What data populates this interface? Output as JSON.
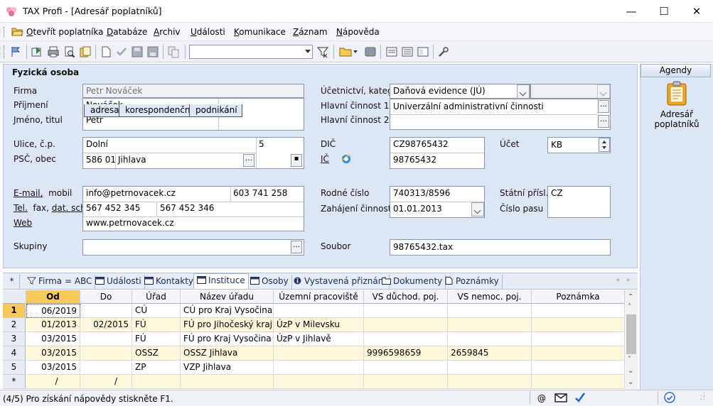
{
  "window": {
    "title": "TAX Profi - [Adresář poplatníků]",
    "minimize_glyph": "—",
    "maximize_glyph": "☐",
    "close_glyph": "✕"
  },
  "menu": {
    "open_u": "O",
    "open_rest": "tevřít poplatníka",
    "db_u": "D",
    "db_rest": "atabáze",
    "archive_u": "A",
    "archive_rest": "rchiv",
    "events_u": "U",
    "events_rest": "dálosti",
    "comm_u": "K",
    "comm_rest": "omunikace",
    "record_u": "Z",
    "record_rest": "áznam",
    "help_u": "N",
    "help_rest": "ápověda"
  },
  "form": {
    "section_title": "Fyzická osoba",
    "labels": {
      "firma": "Firma",
      "prijmeni": "Příjmení",
      "jmeno": "Jméno, titul",
      "ulice": "Ulice, č.p.",
      "psc": "PSČ, obec",
      "email": "E-mail,",
      "mobil": "mobil",
      "tel": "Tel.",
      "fax": "fax,",
      "datschr": "dat. schr.",
      "web": "Web",
      "skupiny": "Skupiny",
      "ucetnictvi": "Účetnictví, kateg.",
      "cinnost1": "Hlavní činnost 1",
      "cinnost2": "Hlavní činnost 2",
      "dic": "DIČ",
      "ic": "IČ",
      "ucet": "Účet",
      "rodne": "Rodné číslo",
      "zahajeni": "Zahájení činnosti",
      "statni": "Státní přísl.",
      "pas": "Číslo pasu",
      "soubor": "Soubor"
    },
    "values": {
      "firma": "Petr Nováček",
      "prijmeni": "Nováček",
      "jmeno": "Petr",
      "ulice": "Dolní",
      "cp": "5",
      "psc": "586 01",
      "obec": "Jihlava",
      "email": "info@petrnovacek.cz",
      "mobil": "603 741 258",
      "tel": "567 452 345",
      "fax": "567 452 346",
      "web": "www.petrnovacek.cz",
      "skupiny": "",
      "ucetnictvi": "Daňová evidence (JÚ)",
      "cinnost1": "Univerzální administrativní činnosti",
      "cinnost2": "",
      "dic": "CZ98765432",
      "ic": "98765432",
      "ucet": "KB",
      "rodne": "740313/8596",
      "zahajeni": "01.01.2013",
      "statni": "CZ",
      "pas": "",
      "soubor": "98765432.tax"
    },
    "address_tabs": [
      "adresa",
      "korespondenční",
      "podnikání"
    ]
  },
  "agenda": {
    "header": "Agendy",
    "item_line1": "Adresář",
    "item_line2": "poplatníků"
  },
  "tabs": {
    "asterisk": "*",
    "firma": "Firma = ABC",
    "udalosti": "Události",
    "kontakty": "Kontakty",
    "instituce": "Instituce",
    "osoby": "Osoby",
    "priznani": "Vystavená přiznání",
    "dokumenty": "Dokumenty",
    "poznamky": "Poznámky"
  },
  "grid": {
    "columns": [
      "Od",
      "Do",
      "Úřad",
      "Název úřadu",
      "Územní pracoviště",
      "VS důchod. poj.",
      "VS nemoc. poj.",
      "Poznámka"
    ],
    "rows": [
      {
        "n": "1",
        "od": "06/2019",
        "do": "",
        "urad": "CÚ",
        "nazev": "CÚ pro Kraj Vysočina",
        "uzemni": "",
        "vsd": "",
        "vsn": "",
        "pozn": ""
      },
      {
        "n": "2",
        "od": "01/2013",
        "do": "02/2015",
        "urad": "FÚ",
        "nazev": "FÚ pro Jihočeský kraj",
        "uzemni": "ÚzP v Milevsku",
        "vsd": "",
        "vsn": "",
        "pozn": ""
      },
      {
        "n": "3",
        "od": "03/2015",
        "do": "",
        "urad": "FÚ",
        "nazev": "FÚ pro Kraj Vysočina",
        "uzemni": "ÚzP v Jihlavě",
        "vsd": "",
        "vsn": "",
        "pozn": ""
      },
      {
        "n": "4",
        "od": "03/2015",
        "do": "",
        "urad": "OSSZ",
        "nazev": "OSSZ Jihlava",
        "uzemni": "",
        "vsd": "9996598659",
        "vsn": "2659845",
        "pozn": ""
      },
      {
        "n": "5",
        "od": "03/2015",
        "do": "",
        "urad": "ZP",
        "nazev": "VZP Jihlava",
        "uzemni": "",
        "vsd": "",
        "vsn": "",
        "pozn": ""
      },
      {
        "n": "*",
        "od": "/",
        "do": "/",
        "urad": "",
        "nazev": "",
        "uzemni": "",
        "vsd": "",
        "vsn": "",
        "pozn": ""
      }
    ]
  },
  "status": {
    "text": "(4/5)  Pro získání nápovědy stiskněte F1.",
    "at": "@"
  },
  "colors": {
    "accent": "#dde6f4",
    "highlight_row": "#fdf8dc",
    "selected_header": "#f7c95a"
  }
}
